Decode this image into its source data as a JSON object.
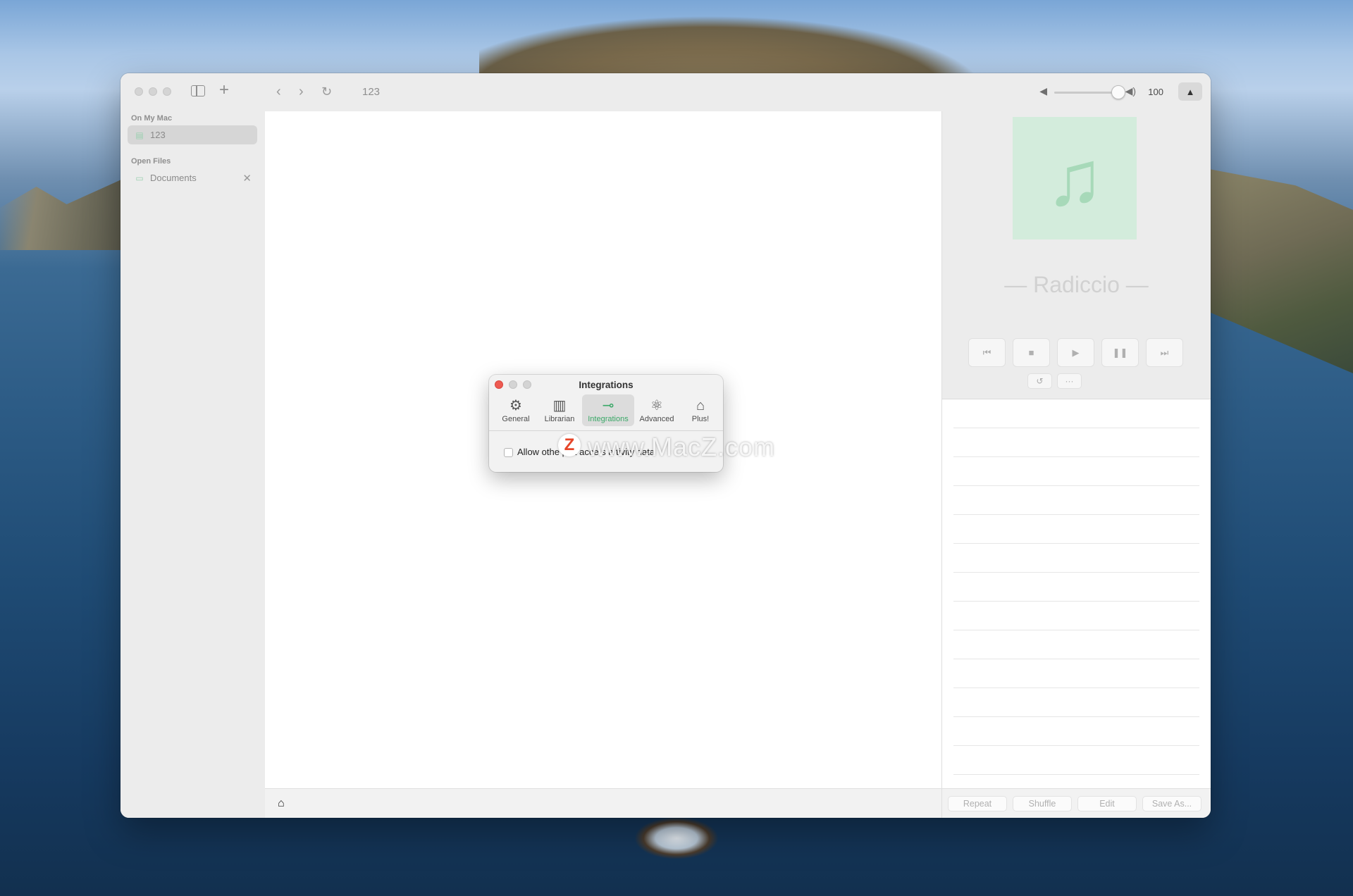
{
  "sidebar": {
    "sections": [
      {
        "label": "On My Mac",
        "items": [
          {
            "label": "123",
            "selected": true
          }
        ]
      },
      {
        "label": "Open Files",
        "items": [
          {
            "label": "Documents",
            "closable": true
          }
        ]
      }
    ]
  },
  "toolbar": {
    "title": "123",
    "volume_level": 100,
    "volume_label": "100"
  },
  "player": {
    "track_title": "— Radiccio —",
    "controls": [
      "previous-icon",
      "stop-icon",
      "play-icon",
      "pause-icon",
      "next-icon"
    ],
    "sub_controls": [
      "reload-icon",
      "more-icon"
    ]
  },
  "bottom_buttons": {
    "repeat": "Repeat",
    "shuffle": "Shuffle",
    "edit": "Edit",
    "save_as": "Save As..."
  },
  "dialog": {
    "title": "Integrations",
    "tabs": [
      {
        "label": "General",
        "icon": "gear-icon"
      },
      {
        "label": "Librarian",
        "icon": "books-icon"
      },
      {
        "label": "Integrations",
        "icon": "plug-icon",
        "active": true
      },
      {
        "label": "Advanced",
        "icon": "atom-icon"
      },
      {
        "label": "Plus!",
        "icon": "store-icon"
      }
    ],
    "checkbox_label": "Allow othe   ps t  acce s a tivity data",
    "checkbox_checked": false
  },
  "watermark": "www.MacZ.com",
  "watermark_logo": "Z",
  "colors": {
    "accent": "#3aa867",
    "close": "#ee5b52"
  }
}
